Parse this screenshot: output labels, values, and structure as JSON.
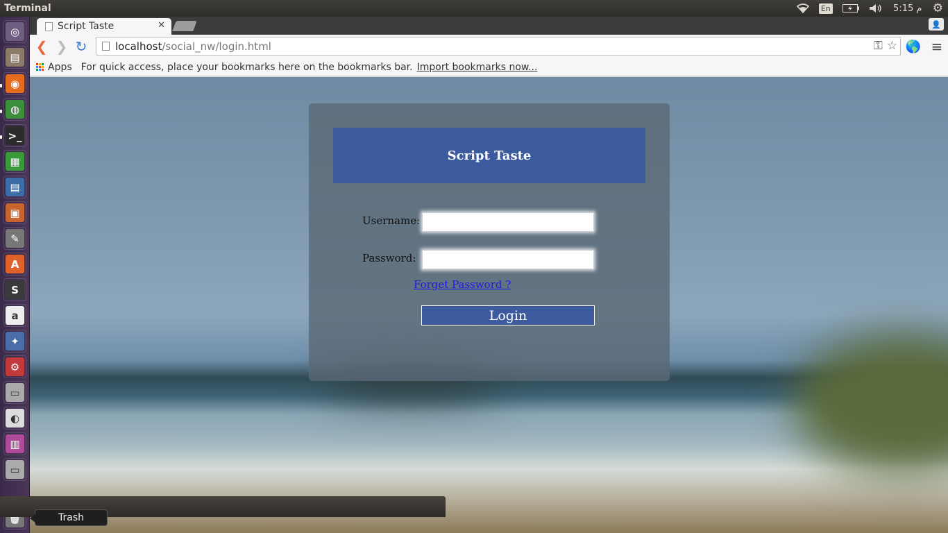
{
  "panel": {
    "app_title": "Terminal",
    "lang": "En",
    "clock": "5:15 م"
  },
  "launcher": {
    "items": [
      {
        "name": "dash-icon",
        "glyph": "◎",
        "color": "#6d5d80"
      },
      {
        "name": "files-icon",
        "glyph": "▤",
        "color": "#8d7b6a"
      },
      {
        "name": "firefox-icon",
        "glyph": "◉",
        "color": "#e46c1f"
      },
      {
        "name": "chrome-icon",
        "glyph": "◍",
        "color": "#3b8f3b"
      },
      {
        "name": "terminal-icon",
        "glyph": ">_",
        "color": "#2c2c2c"
      },
      {
        "name": "calc-icon",
        "glyph": "▦",
        "color": "#3a9a3a"
      },
      {
        "name": "writer-icon",
        "glyph": "▤",
        "color": "#3b6ea8"
      },
      {
        "name": "impress-icon",
        "glyph": "▣",
        "color": "#c8642f"
      },
      {
        "name": "text-editor-icon",
        "glyph": "✎",
        "color": "#777"
      },
      {
        "name": "software-center-icon",
        "glyph": "A",
        "color": "#e0622a"
      },
      {
        "name": "sublime-icon",
        "glyph": "S",
        "color": "#3a3a3a"
      },
      {
        "name": "amazon-icon",
        "glyph": "a",
        "color": "#eee"
      },
      {
        "name": "gimp-icon",
        "glyph": "✦",
        "color": "#4a6ea8"
      },
      {
        "name": "settings-icon",
        "glyph": "⚙",
        "color": "#c23a3a"
      },
      {
        "name": "drive-icon",
        "glyph": "▭",
        "color": "#aaa"
      },
      {
        "name": "app-icon",
        "glyph": "◐",
        "color": "#ddd"
      },
      {
        "name": "workspace-icon",
        "glyph": "▥",
        "color": "#b04a9a"
      },
      {
        "name": "drive2-icon",
        "glyph": "▭",
        "color": "#aaa"
      }
    ],
    "trash_tooltip": "Trash"
  },
  "browser": {
    "tab_title": "Script Taste",
    "url_host": "localhost",
    "url_path": "/social_nw/login.html",
    "bookmarks_apps": "Apps",
    "bookmarks_hint": "For quick access, place your bookmarks here on the bookmarks bar.",
    "import_link": "Import bookmarks now..."
  },
  "login": {
    "title": "Script Taste",
    "username_label": "Username:",
    "password_label": "Password:",
    "username_value": "",
    "password_value": "",
    "forget_link": "Forget Password ?",
    "login_button": "Login"
  }
}
